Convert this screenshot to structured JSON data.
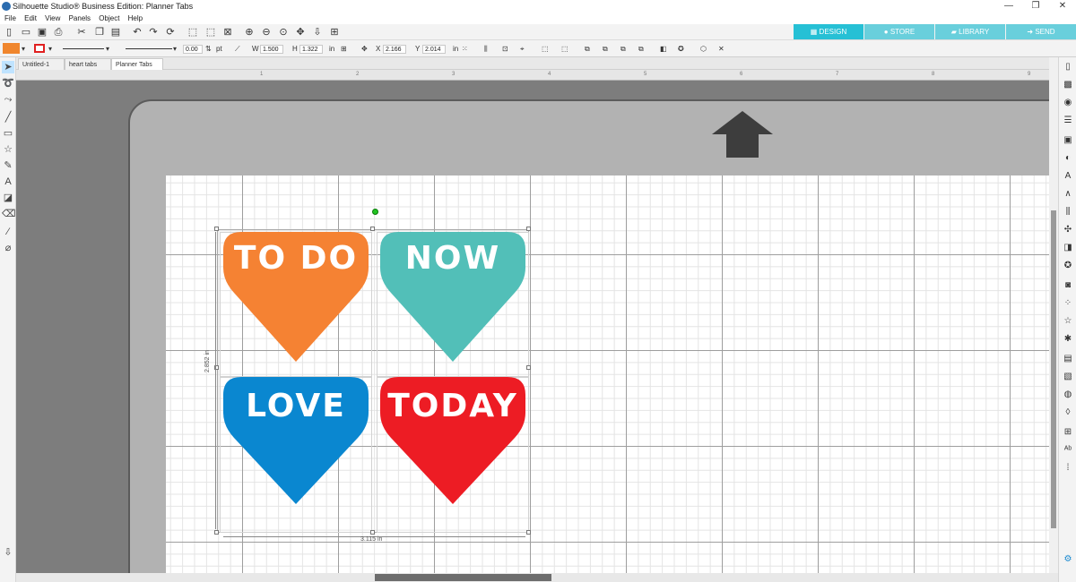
{
  "app": {
    "title": "Silhouette Studio® Business Edition: Planner Tabs"
  },
  "window_controls": {
    "minimize": "—",
    "restore": "❐",
    "close": "✕"
  },
  "menu": [
    "File",
    "Edit",
    "View",
    "Panels",
    "Object",
    "Help"
  ],
  "nav_tabs": [
    {
      "label": "DESIGN",
      "icon": "grid-icon"
    },
    {
      "label": "STORE",
      "icon": "store-icon"
    },
    {
      "label": "LIBRARY",
      "icon": "library-icon"
    },
    {
      "label": "SEND",
      "icon": "send-icon"
    }
  ],
  "properties": {
    "line_width": "0.00",
    "line_unit": "pt",
    "w_label": "W",
    "w_value": "1.500",
    "h_label": "H",
    "h_value": "1.322",
    "size_unit": "in",
    "x_label": "X",
    "x_value": "2.166",
    "y_label": "Y",
    "y_value": "2.014",
    "pos_unit": "in"
  },
  "colors": {
    "fill": "#f0862d",
    "accent": "#26c0d5",
    "heart_orange": "#f58233",
    "heart_teal": "#52bfb8",
    "heart_blue": "#0a87d0",
    "heart_red": "#ed1c24"
  },
  "doc_tabs": [
    {
      "label": "Untitled-1"
    },
    {
      "label": "heart tabs"
    },
    {
      "label": "Planner Tabs"
    }
  ],
  "hearts": [
    {
      "label": "TO DO",
      "color": "#f58233"
    },
    {
      "label": "NOW",
      "color": "#52bfb8"
    },
    {
      "label": "LOVE",
      "color": "#0a87d0"
    },
    {
      "label": "TODAY",
      "color": "#ed1c24"
    }
  ],
  "dimensions": {
    "width": "3.115 in",
    "height": "2.852 in"
  },
  "ruler": {
    "marks": [
      "1",
      "2",
      "3",
      "4",
      "5",
      "6",
      "7",
      "8",
      "9"
    ]
  }
}
